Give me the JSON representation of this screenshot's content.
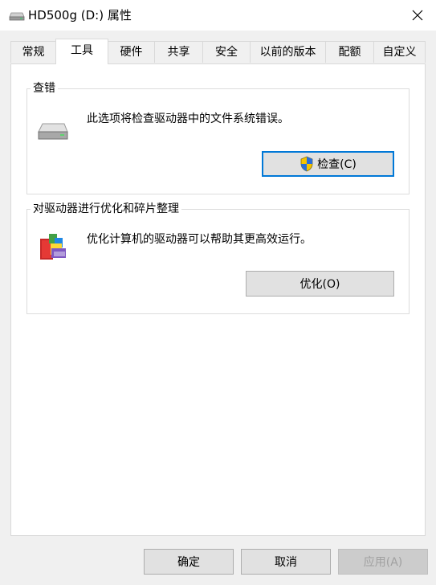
{
  "window": {
    "title": "HD500g (D:) 属性",
    "icon": "drive-icon",
    "close_glyph": "✕"
  },
  "tabs": [
    {
      "label": "常规",
      "active": false
    },
    {
      "label": "工具",
      "active": true
    },
    {
      "label": "硬件",
      "active": false
    },
    {
      "label": "共享",
      "active": false
    },
    {
      "label": "安全",
      "active": false
    },
    {
      "label": "以前的版本",
      "active": false
    },
    {
      "label": "配额",
      "active": false
    },
    {
      "label": "自定义",
      "active": false
    }
  ],
  "error_check": {
    "title": "查错",
    "description": "此选项将检查驱动器中的文件系统错误。",
    "button_label": "检查(C)"
  },
  "optimize": {
    "title": "对驱动器进行优化和碎片整理",
    "description": "优化计算机的驱动器可以帮助其更高效运行。",
    "button_label": "优化(O)"
  },
  "footer": {
    "ok_label": "确定",
    "cancel_label": "取消",
    "apply_label": "应用(A)"
  },
  "colors": {
    "default_button_border": "#0078d7",
    "window_background": "#f0f0f0"
  }
}
